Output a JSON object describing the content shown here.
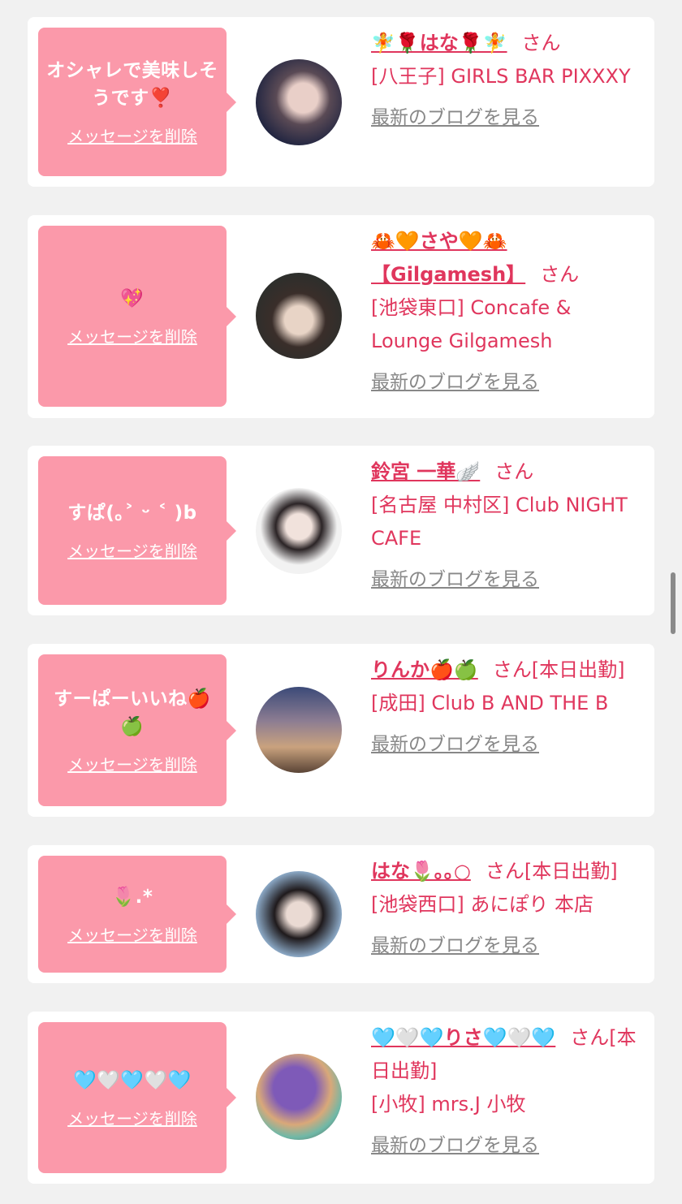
{
  "cards": [
    {
      "message": "オシャレで美味しそうです❣️",
      "delete_label": "メッセージを削除",
      "name": "🧚🌹はな🌹🧚",
      "suffix": "さん",
      "shop": "[八王子] GIRLS BAR PIXXXY",
      "blog_label": "最新のブログを見る"
    },
    {
      "message": "💖",
      "delete_label": "メッセージを削除",
      "name": "🦀🧡さや🧡🦀【Gilgamesh】",
      "suffix": "さん",
      "shop": "[池袋東口] Concafe & Lounge Gilgamesh",
      "blog_label": "最新のブログを見る"
    },
    {
      "message": "すぱ(｡˃ ᵕ ˂ )b",
      "delete_label": "メッセージを削除",
      "name": "鈴宮 一華🪽",
      "suffix": "さん",
      "shop": "[名古屋 中村区] Club NIGHT CAFE",
      "blog_label": "最新のブログを見る"
    },
    {
      "message": "すーぱーいいね🍎🍏",
      "delete_label": "メッセージを削除",
      "name": "りんか🍎🍏",
      "suffix": "さん[本日出勤]",
      "shop": "[成田] Club B AND THE B",
      "blog_label": "最新のブログを見る"
    },
    {
      "message": "🌷.*",
      "delete_label": "メッセージを削除",
      "name": "はな🌷｡｡○",
      "suffix": "さん[本日出勤]",
      "shop": "[池袋西口] あにぽり 本店",
      "blog_label": "最新のブログを見る"
    },
    {
      "message": "🩵🤍🩵🤍🩵",
      "delete_label": "メッセージを削除",
      "name": "🩵🤍🩵りさ🩵🤍🩵",
      "suffix": "さん[本日出勤]",
      "shop": "[小牧] mrs.J 小牧",
      "blog_label": "最新のブログを見る"
    }
  ],
  "colors": {
    "background": "#f1f1f1",
    "bubble": "#fb99aa",
    "accent": "#e0365d",
    "link_gray": "#888888"
  }
}
